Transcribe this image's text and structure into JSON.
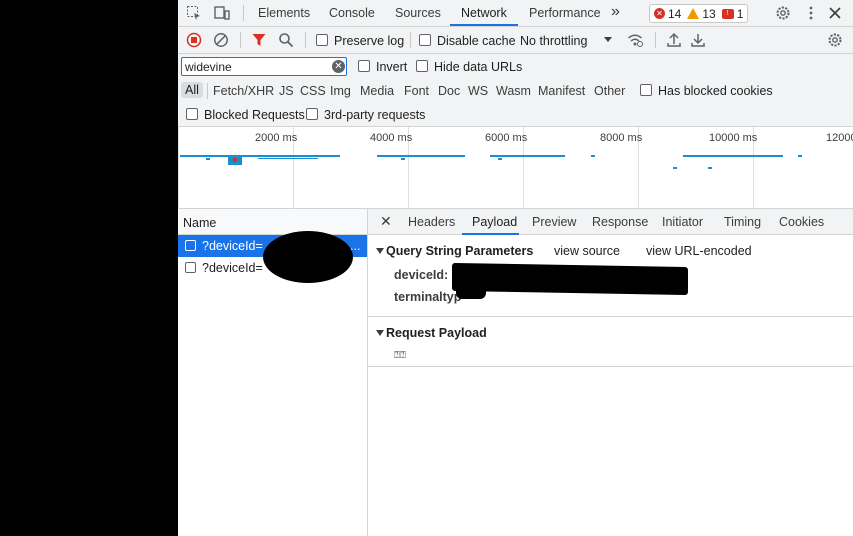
{
  "tabs": {
    "elements": "Elements",
    "console": "Console",
    "sources": "Sources",
    "network": "Network",
    "performance": "Performance",
    "more": "»"
  },
  "badges": {
    "errors": "14",
    "warnings": "13",
    "issues": "1"
  },
  "toolbar": {
    "preserve_log": "Preserve log",
    "disable_cache": "Disable cache",
    "throttling": "No throttling"
  },
  "filter": {
    "value": "widevine",
    "invert": "Invert",
    "hide_data_urls": "Hide data URLs"
  },
  "types": [
    "All",
    "Fetch/XHR",
    "JS",
    "CSS",
    "Img",
    "Media",
    "Font",
    "Doc",
    "WS",
    "Wasm",
    "Manifest",
    "Other"
  ],
  "has_blocked_cookies": "Has blocked cookies",
  "blocked_requests": "Blocked Requests",
  "third_party": "3rd-party requests",
  "timeline": {
    "labels": [
      "2000 ms",
      "4000 ms",
      "6000 ms",
      "8000 ms",
      "10000 ms",
      "12000"
    ]
  },
  "request_list": {
    "header": "Name",
    "rows": [
      {
        "name": "?deviceId=",
        "suffix": "..."
      },
      {
        "name": "?deviceId=",
        "suffix": ""
      }
    ]
  },
  "detail": {
    "close": "✕",
    "tabs": [
      "Headers",
      "Payload",
      "Preview",
      "Response",
      "Initiator",
      "Timing",
      "Cookies"
    ],
    "qs_title": "Query String Parameters",
    "view_source": "view source",
    "view_url_encoded": "view URL-encoded",
    "params": [
      {
        "key": "deviceId:"
      },
      {
        "key": "terminaltyp"
      }
    ],
    "payload_title": "Request Payload",
    "payload_value": "⍰⍰"
  },
  "colors": {
    "accent": "#1a73e8",
    "error": "#d93025",
    "warning": "#f29900"
  }
}
